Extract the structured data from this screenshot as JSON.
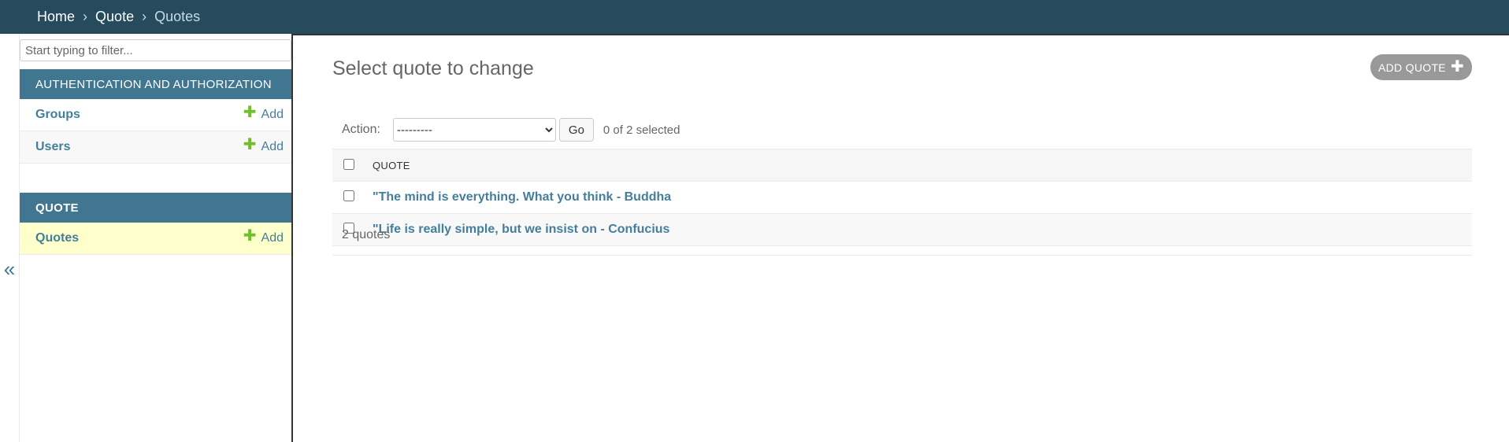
{
  "breadcrumbs": {
    "home": "Home",
    "separator": "›",
    "app": "Quote",
    "current": "Quotes"
  },
  "sidebar": {
    "filter_placeholder": "Start typing to filter...",
    "toggle_glyph": "«",
    "modules": [
      {
        "header": "AUTHENTICATION AND AUTHORIZATION",
        "items": [
          {
            "label": "Groups",
            "add": "Add"
          },
          {
            "label": "Users",
            "add": "Add"
          }
        ]
      },
      {
        "header": "QUOTE",
        "items": [
          {
            "label": "Quotes",
            "add": "Add"
          }
        ]
      }
    ]
  },
  "main": {
    "title": "Select quote to change",
    "add_button": "ADD QUOTE",
    "action_label": "Action:",
    "action_selected": "---------",
    "go_label": "Go",
    "selection_counter": "0 of 2 selected",
    "column_header": "QUOTE",
    "rows": [
      "\"The mind is everything. What you think - Buddha",
      "\"Life is really simple, but we insist on - Confucius"
    ],
    "paginator": "2 quotes"
  },
  "colors": {
    "header_bg": "#264b5d",
    "module_bg": "#417690",
    "link": "#447e9b",
    "add_plus": "#70bf2b",
    "active_row": "#ffffcc"
  }
}
